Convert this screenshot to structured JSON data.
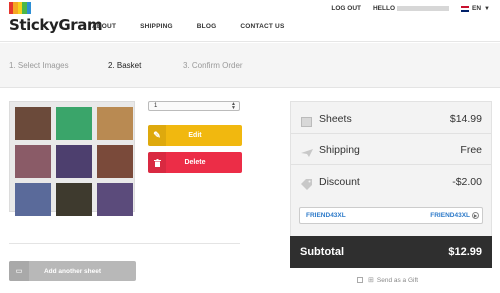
{
  "brand": {
    "name": "StickyGram",
    "stripe_colors": [
      "#e5352d",
      "#f5a623",
      "#f8d21c",
      "#4cb748",
      "#2d8fd5"
    ]
  },
  "nav": {
    "items": [
      "ABOUT",
      "SHIPPING",
      "BLOG",
      "CONTACT US"
    ]
  },
  "topbar": {
    "logout": "LOG OUT",
    "hello": "HELLO",
    "language": "EN"
  },
  "steps": [
    {
      "label": "1.  Select Images",
      "active": false
    },
    {
      "label": "2.  Basket",
      "active": true
    },
    {
      "label": "3.  Confirm Order",
      "active": false
    }
  ],
  "sheet": {
    "quantity": "1",
    "photo_colors": [
      "#6b4a3a",
      "#3aa56a",
      "#b98a52",
      "#8a5b67",
      "#4d3f6e",
      "#7a4a3a",
      "#5a6a9a",
      "#3e3a2e",
      "#5b4b7b"
    ]
  },
  "actions": {
    "edit": "Edit",
    "delete": "Delete",
    "add_sheet": "Add another sheet"
  },
  "summary": {
    "sheets_label": "Sheets",
    "sheets_value": "$14.99",
    "shipping_label": "Shipping",
    "shipping_value": "Free",
    "discount_label": "Discount",
    "discount_value": "-$2.00",
    "coupon_code": "FRIEND43XL",
    "coupon_applied": "FRIEND43XL",
    "subtotal_label": "Subtotal",
    "subtotal_value": "$12.99",
    "gift_label": "Send as a Gift"
  }
}
